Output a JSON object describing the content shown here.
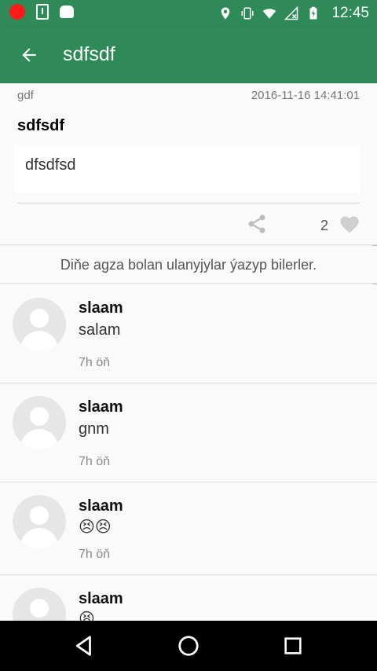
{
  "status_bar": {
    "time": "12:45",
    "left_icons": [
      "record-icon",
      "sim-icon",
      "android-icon"
    ],
    "right_icons": [
      "location-icon",
      "vibrate-icon",
      "wifi-icon",
      "no-signal-icon",
      "battery-charging-icon"
    ]
  },
  "app_bar": {
    "title": "sdfsdf",
    "back_icon": "arrow-left-icon",
    "color": "#2e8b57"
  },
  "post": {
    "author": "gdf",
    "date": "2016-11-16 14:41:01",
    "title": "sdfsdf",
    "body": "dfsdfsd",
    "like_count": "2",
    "share_icon": "share-icon",
    "like_icon": "heart-icon"
  },
  "notice": "Diňe agza bolan ulanyjylar ýazyp bilerler.",
  "comments": [
    {
      "name": "slaam",
      "text": "salam",
      "time": "7h öň"
    },
    {
      "name": "slaam",
      "text": "gnm",
      "time": "7h öň"
    },
    {
      "name": "slaam",
      "text": "😣😣",
      "time": "7h öň"
    },
    {
      "name": "slaam",
      "text": "😫",
      "time": ""
    }
  ],
  "nav_bar": {
    "buttons": [
      "back-triangle-icon",
      "home-circle-icon",
      "recents-square-icon"
    ]
  }
}
